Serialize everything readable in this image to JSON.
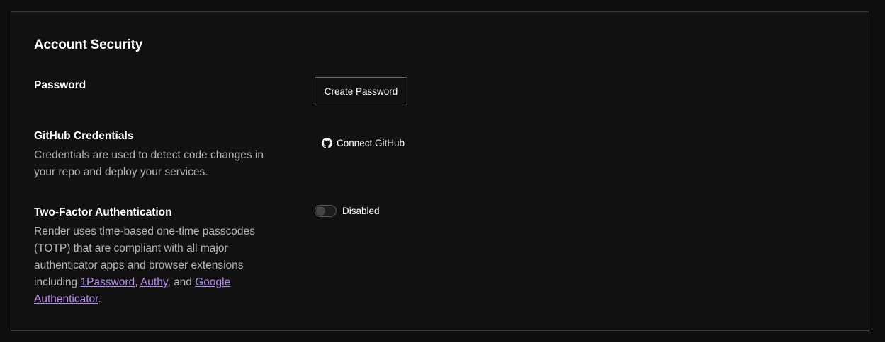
{
  "section": {
    "title": "Account Security"
  },
  "password": {
    "label": "Password",
    "button_label": "Create Password"
  },
  "github": {
    "label": "GitHub Credentials",
    "description": "Credentials are used to detect code changes in your repo and deploy your services.",
    "button_label": "Connect GitHub",
    "icon": "github-icon"
  },
  "two_factor": {
    "label": "Two-Factor Authentication",
    "description_prefix": "Render uses time-based one-time passcodes (TOTP) that are compliant with all major authenticator apps and browser extensions including ",
    "links": [
      "1Password",
      "Authy",
      "Google Authenticator"
    ],
    "sep_comma": ", ",
    "sep_and": ", and ",
    "description_suffix": ".",
    "toggle_state_label": "Disabled",
    "enabled": false
  },
  "colors": {
    "background": "#0e0e0e",
    "panel": "#111111",
    "border": "#3a3a3a",
    "link": "#b48ef0",
    "muted_text": "#b8b8b8"
  }
}
